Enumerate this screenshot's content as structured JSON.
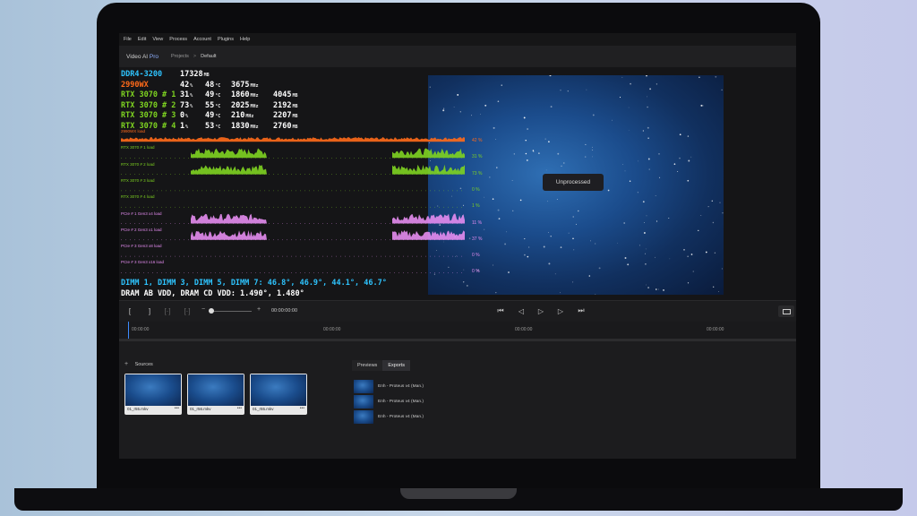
{
  "menu": [
    "File",
    "Edit",
    "View",
    "Process",
    "Account",
    "Plugins",
    "Help"
  ],
  "app": {
    "title_main": "Video AI",
    "title_pro": "Pro"
  },
  "breadcrumb": {
    "projects": "Projects",
    "separator": ">",
    "current": "Default"
  },
  "osd": {
    "rows": [
      {
        "name": "DDR4-3200",
        "color": "#2ec4ff",
        "v1": "17328",
        "u1": "MB",
        "v2": "",
        "u2": "",
        "v3": "",
        "u3": "",
        "v4": "",
        "u4": ""
      },
      {
        "name": "2990WX",
        "color": "#ff6a1a",
        "v1": "42",
        "u1": "%",
        "v2": "48",
        "u2": "°C",
        "v3": "3675",
        "u3": "MHz",
        "v4": "",
        "u4": ""
      },
      {
        "name": "RTX 3070 # 1",
        "color": "#7ed321",
        "v1": "31",
        "u1": "%",
        "v2": "49",
        "u2": "°C",
        "v3": "1860",
        "u3": "MHz",
        "v4": "4045",
        "u4": "MB"
      },
      {
        "name": "RTX 3070 # 2",
        "color": "#7ed321",
        "v1": "73",
        "u1": "%",
        "v2": "55",
        "u2": "°C",
        "v3": "2025",
        "u3": "MHz",
        "v4": "2192",
        "u4": "MB"
      },
      {
        "name": "RTX 3070 # 3",
        "color": "#7ed321",
        "v1": "0",
        "u1": "%",
        "v2": "49",
        "u2": "°C",
        "v3": "210",
        "u3": "MHz",
        "v4": "2207",
        "u4": "MB"
      },
      {
        "name": "RTX 3070 # 4",
        "color": "#7ed321",
        "v1": "1",
        "u1": "%",
        "v2": "53",
        "u2": "°C",
        "v3": "1830",
        "u3": "MHz",
        "v4": "2760",
        "u4": "MB"
      }
    ],
    "graphs": [
      {
        "label": "2990WX load",
        "pct": "42 %",
        "color": "#ff6a1a"
      },
      {
        "label": "RTX 3070 # 1 load",
        "pct": "31 %",
        "color": "#7ed321"
      },
      {
        "label": "RTX 3070 # 2 load",
        "pct": "73 %",
        "color": "#7ed321"
      },
      {
        "label": "RTX 3070 # 3 load",
        "pct": "0 %",
        "color": "#7ed321"
      },
      {
        "label": "RTX 3070 # 4 load",
        "pct": "1 %",
        "color": "#7ed321"
      },
      {
        "label": "PCIe # 1  Gen3 x4  load",
        "pct": "11 %",
        "color": "#e48cf0"
      },
      {
        "label": "PCIe # 2  Gen3 x1  load",
        "pct": "37 %",
        "color": "#e48cf0"
      },
      {
        "label": "PCIe # 3  Gen3 x8  load",
        "pct": "0 %",
        "color": "#e48cf0"
      },
      {
        "label": "PCIe # 3  Gen3 x16  load",
        "pct": "0 %",
        "color": "#e48cf0"
      }
    ],
    "dimm_line": "DIMM 1, DIMM 3, DIMM 5, DIMM 7: 46.8°, 46.9°, 44.1°, 46.7°",
    "vdd_line": "DRAM AB VDD, DRAM CD VDD: 1.490°, 1.480°"
  },
  "viewer": {
    "status": "Unprocessed"
  },
  "transport": {
    "timecode": "00:00:00:00",
    "zoom_minus": "−",
    "zoom_plus": "+"
  },
  "ruler": {
    "ticks": [
      "00:00:00",
      "00:00:00",
      "00:00:00",
      "00:00:00"
    ]
  },
  "sources": {
    "heading": "Sources",
    "add": "+",
    "items": [
      {
        "name": "01_r55.mkv",
        "menu": "•••"
      },
      {
        "name": "01_r56.mkv",
        "menu": "•••"
      },
      {
        "name": "01_r55.mkv",
        "menu": "•••"
      }
    ]
  },
  "tabs": {
    "previews": "Previews",
    "exports": "Exports"
  },
  "previews": [
    {
      "name": "Enh - Proteus v4 (Man.)"
    },
    {
      "name": "Enh - Proteus v4 (Man.)"
    },
    {
      "name": "Enh - Proteus v4 (Man.)"
    }
  ],
  "colors": {
    "accent": "#3d8bff",
    "dimm": "#2ec4ff",
    "vdd": "#ffffff"
  }
}
